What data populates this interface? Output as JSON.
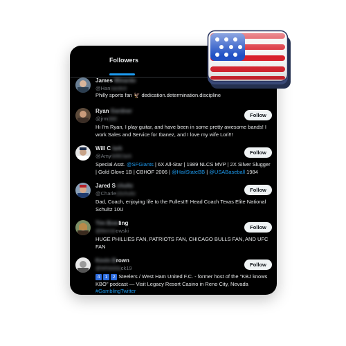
{
  "tab": {
    "label": "Followers"
  },
  "followers": [
    {
      "name": "James",
      "name_blur": "Minardo",
      "handle": "@Han",
      "handle_blur": "nardo3",
      "bio": "Philly sports fan 🦅 dedication.determination.discipline",
      "show_follow": false
    },
    {
      "name": "Ryan",
      "name_blur": "Gardner",
      "handle": "@jrm",
      "handle_blur": "ddd",
      "bio": "Hi I'm Ryan, I play guitar, and have been in some pretty awesome bands! I work Sales and Service for Ibanez, and I love my wife Lori!!!",
      "show_follow": true
    },
    {
      "name": "Will C",
      "name_blur": "lark",
      "handle": "@Amy",
      "handle_blur": "WillClark",
      "bio_parts": [
        {
          "t": "Special Asst. ",
          "m": false
        },
        {
          "t": "@SFGiants",
          "m": true
        },
        {
          "t": " | 6X All-Star | 1989 NLCS MVP | 2X Silver Slugger | Gold Glove 1B | CBHOF 2006 | ",
          "m": false
        },
        {
          "t": "@HailStateBB",
          "m": true
        },
        {
          "t": " | ",
          "m": false
        },
        {
          "t": "@USABaseball",
          "m": true
        },
        {
          "t": " 1984",
          "m": false
        }
      ],
      "show_follow": true
    },
    {
      "name": "Jared S",
      "name_blur": "chultz",
      "handle": "@Charle",
      "handle_blur": "sSchultz",
      "bio": "Dad, Coach, enjoying life to the Fullest!!! Head Coach Texas Elite National Schultz 10U",
      "show_follow": true
    },
    {
      "name": "ling",
      "name_blur": "Tim Bow",
      "handle": "owski",
      "handle_blur": "@Bernie",
      "bio": "HUGE PHILLIES FAN, PATRIOTS FAN, CHICAGO BULLS FAN, AND UFC FAN",
      "show_follow": true
    },
    {
      "name": "rown",
      "name_blur": "Kevin B",
      "handle": "ck19",
      "handle_blur": "@Whitebla",
      "bio_prefix_numbers": [
        "4",
        "1",
        "2"
      ],
      "bio_parts": [
        {
          "t": " Steelers / West Ham United F.C. - former host of the \"KBJ knows KBO\" podcast — Visit Legacy Resort Casino in Reno City, Nevada ",
          "m": false
        },
        {
          "t": "#GamblingTwitter",
          "m": true
        }
      ],
      "show_follow": true
    }
  ],
  "follow_label": "Follow",
  "colors": {
    "accent": "#1d9bf0",
    "background": "#000000",
    "flag_red": "#d81e2a",
    "flag_blue": "#1f4fc4"
  },
  "icons": {
    "flag": "american-flag-icon",
    "eagle": "eagle-emoji"
  }
}
